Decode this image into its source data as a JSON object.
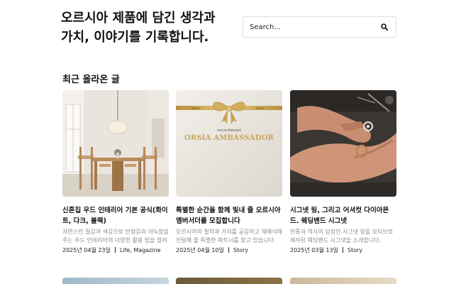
{
  "hero": {
    "title_line1": "오르시아 제품에 담긴 생각과",
    "title_line2": "가치, 이야기를 기록합니다."
  },
  "search": {
    "placeholder": "Search...",
    "icon": "search-icon"
  },
  "section": {
    "title": "최근 올라온 글"
  },
  "posts": [
    {
      "image": "dining-room-interior-photo",
      "title": "신혼집 우드 인테리어 기본 공식(화이트, 다크, 블랙)",
      "excerpt": "자연스런 질감과 색감으로 안정감과 아늑함을 주는 우드 인테리어의 다양한 활용 팁을 알려드립니다.",
      "date": "2025년 04월 23일",
      "category": "Life, Magazine"
    },
    {
      "image": "gold-ribbon-recruitment-card",
      "image_text": {
        "ribbon_left": "ORSIA",
        "ribbon_right": "ORSIA",
        "small": "recruitment",
        "big": "ORSIA AMBASSADOR"
      },
      "title": "특별한 순간을 함께 빛내 줄 오르시아 앰버서더를 모집합니다",
      "excerpt": "오르시아의 철학과 가치를 공감하고 재해석해 전달해 줄 특별한 파트너를 찾고 있습니다.",
      "date": "2025년 04월 10일",
      "category": "Story"
    },
    {
      "image": "hands-holding-rings-photo",
      "title": "시그넷 링, 그리고 어셔컷 다이아몬드. 웨딩밴드 시그넷",
      "excerpt": "전통과 역사의 상징인 시그넷 링을 모티브로 제작된 웨딩밴드 시그넷을 소개합니다.",
      "date": "2025년 03월 13일",
      "category": "Story"
    }
  ]
}
